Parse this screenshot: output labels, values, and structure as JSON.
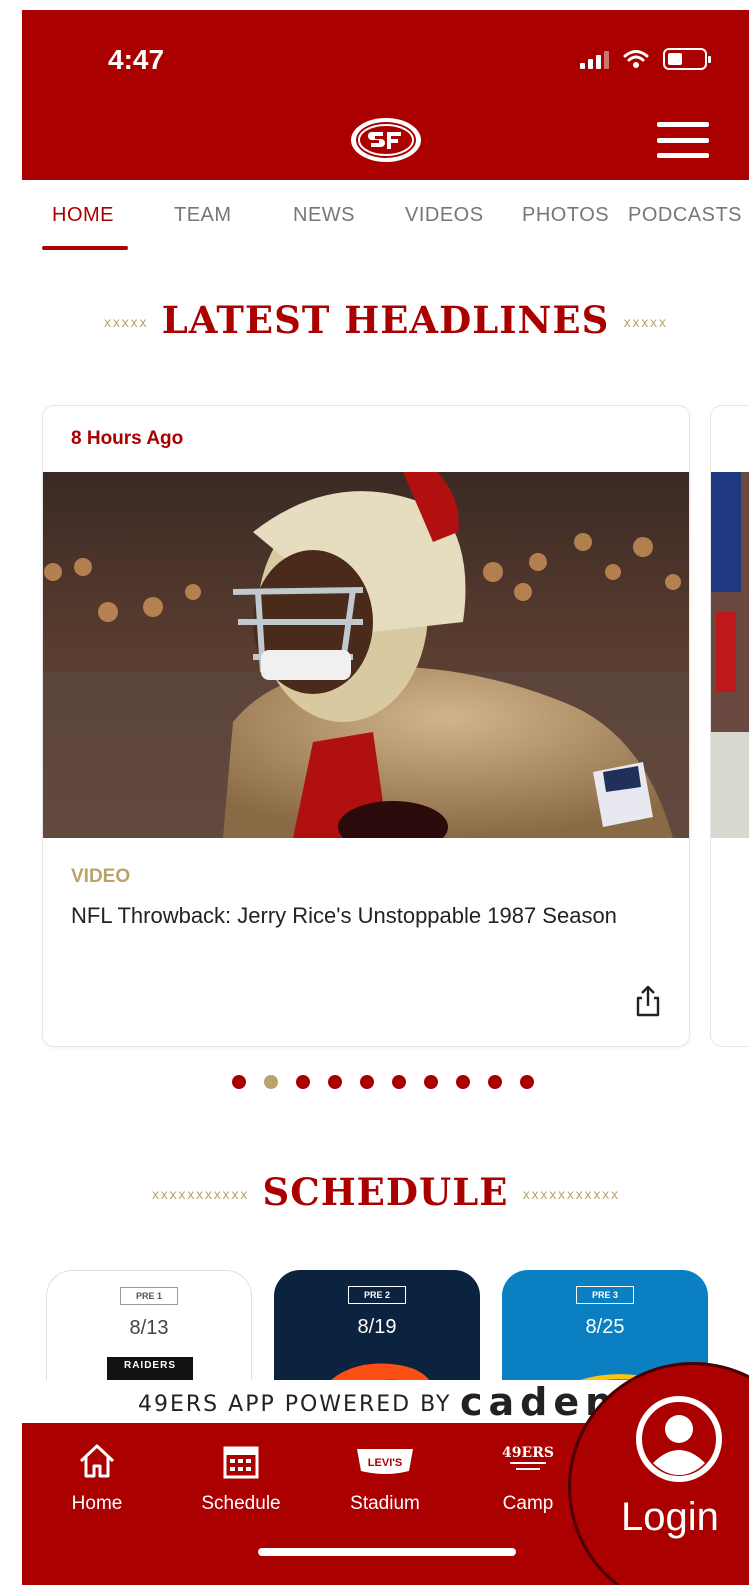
{
  "status_bar": {
    "time": "4:47"
  },
  "tabs": [
    {
      "label": "HOME",
      "active": true
    },
    {
      "label": "TEAM",
      "active": false
    },
    {
      "label": "NEWS",
      "active": false
    },
    {
      "label": "VIDEOS",
      "active": false
    },
    {
      "label": "PHOTOS",
      "active": false
    },
    {
      "label": "PODCASTS",
      "active": false
    }
  ],
  "headlines": {
    "title": "LATEST HEADLINES",
    "card": {
      "time": "8 Hours Ago",
      "type": "VIDEO",
      "headline": "NFL Throwback: Jerry Rice's Unstoppable 1987 Season"
    },
    "carousel_count": 10,
    "carousel_active": 2
  },
  "schedule": {
    "title": "SCHEDULE",
    "games": [
      {
        "tag": "PRE 1",
        "date": "8/13",
        "opponent": "RAIDERS",
        "bg": "#ffffff",
        "fg": "#444444"
      },
      {
        "tag": "PRE 2",
        "date": "8/19",
        "opponent": "",
        "bg": "#0c2340",
        "fg": "#ffffff"
      },
      {
        "tag": "PRE 3",
        "date": "8/25",
        "opponent": "",
        "bg": "#0a7fc2",
        "fg": "#ffffff"
      }
    ]
  },
  "powered_by": {
    "text": "49ERS APP POWERED BY",
    "brand": "caden"
  },
  "bottom_nav": {
    "items": [
      {
        "label": "Home",
        "icon": "home-icon"
      },
      {
        "label": "Schedule",
        "icon": "calendar-icon"
      },
      {
        "label": "Stadium",
        "icon": "levis-stadium-icon"
      },
      {
        "label": "Camp",
        "icon": "49ers-camp-icon"
      }
    ],
    "login_label": "Login",
    "stadium_logo_text": "LEVI'S",
    "camp_logo_text": "49ERS"
  },
  "colors": {
    "brand_red": "#aa0000",
    "gold": "#b8a36a"
  }
}
